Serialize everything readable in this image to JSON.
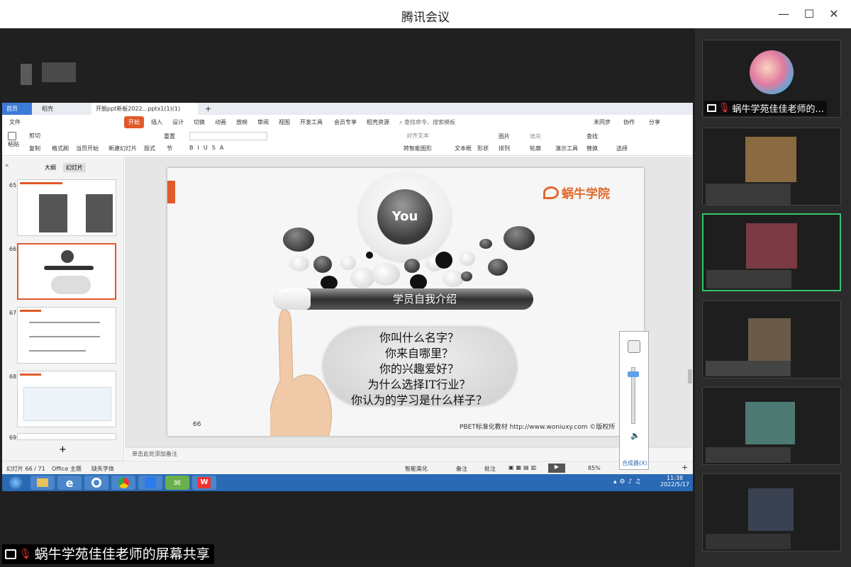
{
  "window": {
    "title": "腾讯会议",
    "min_label": "—",
    "max_label": "☐",
    "close_label": "✕"
  },
  "share_label": "蜗牛学苑佳佳老师的屏幕共享",
  "wps": {
    "tabs": [
      "首页",
      "稻壳",
      "开脱ppt新板2022...pptx1(1)(1)"
    ],
    "ribbon_tabs": [
      "文件",
      "开始",
      "插入",
      "设计",
      "切换",
      "动画",
      "放映",
      "审阅",
      "视图",
      "开发工具",
      "会员专享",
      "稻壳资源"
    ],
    "search_placeholder": "查找命令、搜索模板",
    "right_actions": [
      "未同步",
      "协作",
      "分享"
    ],
    "ribbon": {
      "paste": "粘贴",
      "cut": "剪切",
      "copy": "复制",
      "format_painter": "格式刷",
      "from_current": "当页开始",
      "new_slide": "新建幻灯片",
      "layout": "版式",
      "section": "节",
      "reset": "重置",
      "text_box": "文本框",
      "shape": "形状",
      "picture": "图片",
      "arrange": "排列",
      "fill": "填充",
      "outline": "轮廓",
      "presentation_tools": "演示工具",
      "find": "查找",
      "replace": "替换",
      "select": "选择",
      "align_text": "对齐文本",
      "convert_smartart": "转智能图形"
    },
    "panel_tabs": [
      "大纲",
      "幻灯片"
    ],
    "thumb_numbers": [
      "65",
      "66",
      "67",
      "68",
      "69"
    ],
    "notes_placeholder": "单击此处添加备注",
    "status": {
      "slide_count": "幻灯片 66 / 71",
      "theme": "Office 主题",
      "missing_font": "缺失字体",
      "beautify": "智能美化",
      "notes": "备注",
      "comment": "批注",
      "zoom": "85%"
    },
    "clock": {
      "time": "11:38",
      "date": "2022/5/17"
    }
  },
  "slide": {
    "logo_text": "蜗牛学院",
    "you_label": "You",
    "bar_title": "学员自我介绍",
    "questions": [
      "你叫什么名字？",
      "你来自哪里？",
      "你的兴趣爱好？",
      "为什么选择IT行业？",
      "你认为的学习是什么样子？"
    ],
    "page_num": "66",
    "footer": "PBET标准化教材  http://www.woniuxy.com ©版权所"
  },
  "volume": {
    "mixer_label": "合成器(X)"
  },
  "participants": [
    {
      "name": "蜗牛学苑佳佳老师的..."
    }
  ],
  "colors": {
    "accent": "#e05a2a",
    "active_border": "#35c46a",
    "taskbar": "#2a6ab5"
  }
}
